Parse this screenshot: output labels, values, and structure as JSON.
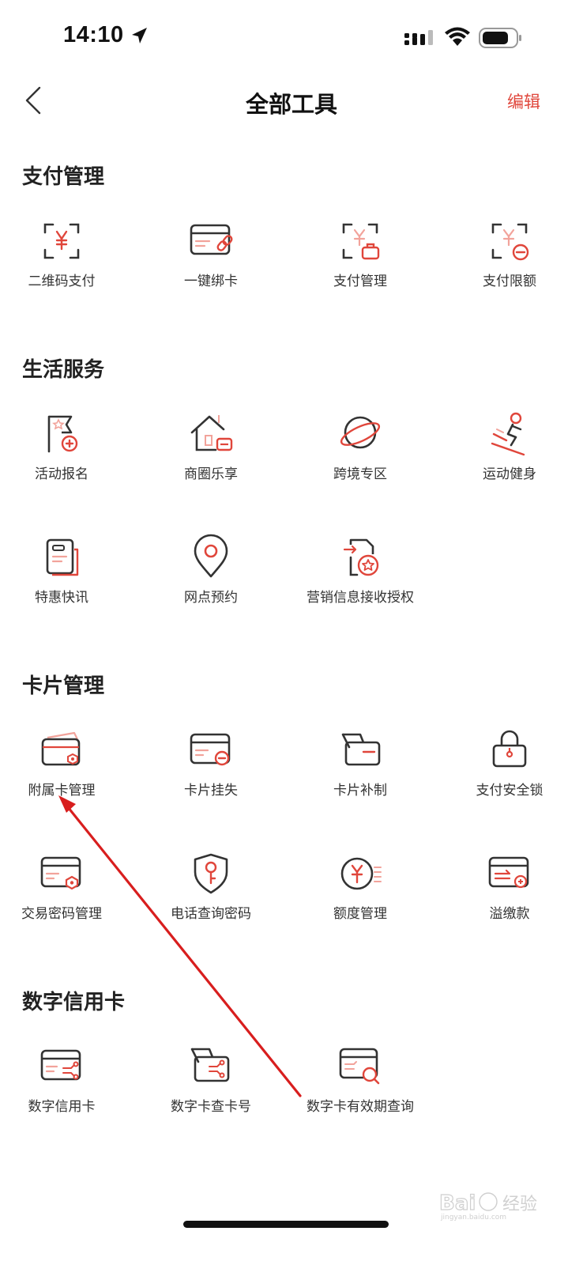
{
  "status_bar": {
    "time": "14:10"
  },
  "nav": {
    "title": "全部工具",
    "edit_label": "编辑"
  },
  "sections": [
    {
      "title": "支付管理",
      "items": [
        "二维码支付",
        "一键绑卡",
        "支付管理",
        "支付限额"
      ]
    },
    {
      "title": "生活服务",
      "items": [
        "活动报名",
        "商圈乐享",
        "跨境专区",
        "运动健身",
        "特惠快讯",
        "网点预约",
        "营销信息接收授权"
      ]
    },
    {
      "title": "卡片管理",
      "items": [
        "附属卡管理",
        "卡片挂失",
        "卡片补制",
        "支付安全锁",
        "交易密码管理",
        "电话查询密码",
        "额度管理",
        "溢缴款"
      ]
    },
    {
      "title": "数字信用卡",
      "items": [
        "数字信用卡",
        "数字卡查卡号",
        "数字卡有效期查询"
      ]
    }
  ],
  "icons": {
    "sections": [
      [
        "qr-pay-icon",
        "bind-card-icon",
        "payment-manage-icon",
        "payment-limit-icon"
      ],
      [
        "event-signup-icon",
        "shopping-district-icon",
        "cross-border-icon",
        "fitness-icon",
        "deals-news-icon",
        "branch-booking-icon",
        "marketing-authorization-icon"
      ],
      [
        "supplementary-card-icon",
        "card-loss-icon",
        "card-replacement-icon",
        "payment-lock-icon",
        "transaction-password-icon",
        "phone-password-icon",
        "credit-limit-icon",
        "overpayment-icon"
      ],
      [
        "digital-card-icon",
        "digital-card-number-icon",
        "digital-card-expiry-icon"
      ]
    ]
  },
  "watermark": {
    "text": "Bai经验",
    "sub": "jingyan.baidu.com"
  },
  "colors": {
    "accent": "#e0463b",
    "icon_dark": "#333333",
    "icon_light": "#f2a39b",
    "arrow": "#d81e1e"
  }
}
